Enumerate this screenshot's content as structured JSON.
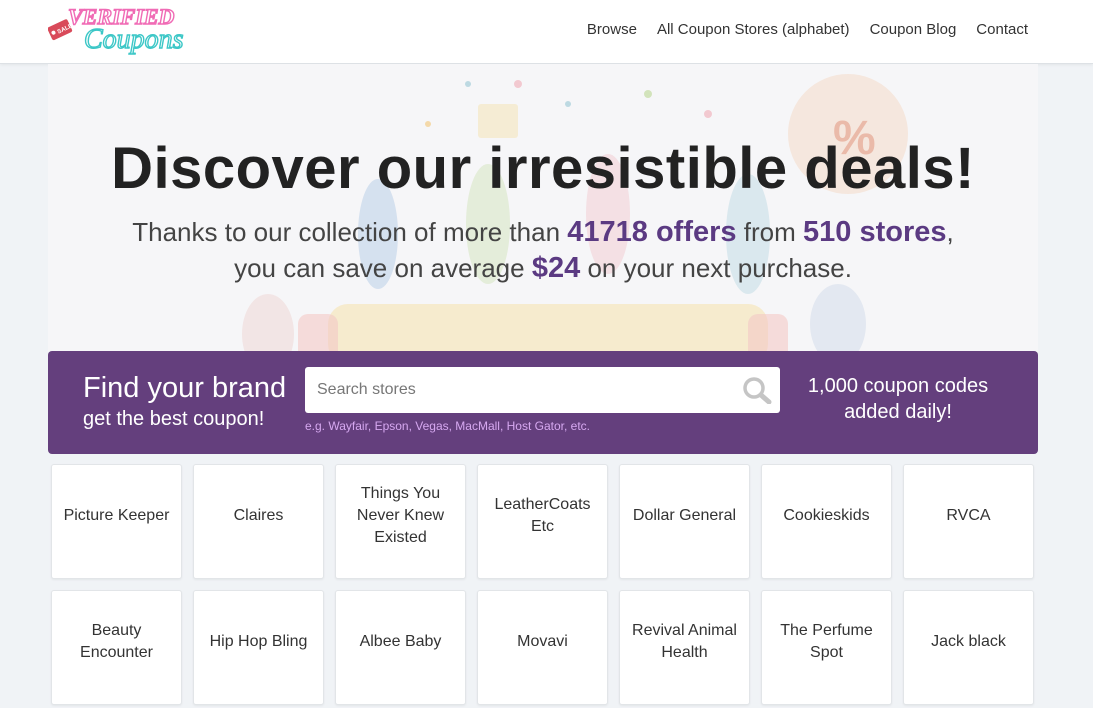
{
  "header": {
    "logo_text_top": "VERIFIED",
    "logo_text_bottom": "Coupons",
    "logo_tag_text": "SALE",
    "nav": [
      "Browse",
      "All Coupon Stores (alphabet)",
      "Coupon Blog",
      "Contact"
    ]
  },
  "hero": {
    "title": "Discover our irresistible deals!",
    "sub_part1": "Thanks to our collection of more than ",
    "offers": "41718 offers",
    "sub_part2": " from ",
    "stores": "510 stores",
    "sub_part3": ",",
    "sub_part4": "you can save on average ",
    "average": "$24",
    "sub_part5": " on your next purchase."
  },
  "search": {
    "title": "Find your brand",
    "subtitle": "get the best coupon!",
    "placeholder": "Search stores",
    "hint": "e.g. Wayfair, Epson, Vegas, MacMall, Host Gator, etc.",
    "right_line1": "1,000 coupon codes",
    "right_line2": "added daily!"
  },
  "stores": [
    "Picture Keeper",
    "Claires",
    "Things You Never Knew Existed",
    "LeatherCoats Etc",
    "Dollar General",
    "Cookieskids",
    "RVCA",
    "Beauty Encounter",
    "Hip Hop Bling",
    "Albee Baby",
    "Movavi",
    "Revival Animal Health",
    "The Perfume Spot",
    "Jack black"
  ],
  "colors": {
    "accent": "#643f7d",
    "highlight": "#5b3a82",
    "hint": "#d6a8f0",
    "logo_pink": "#f06bb5",
    "logo_teal": "#3cc7c7"
  }
}
